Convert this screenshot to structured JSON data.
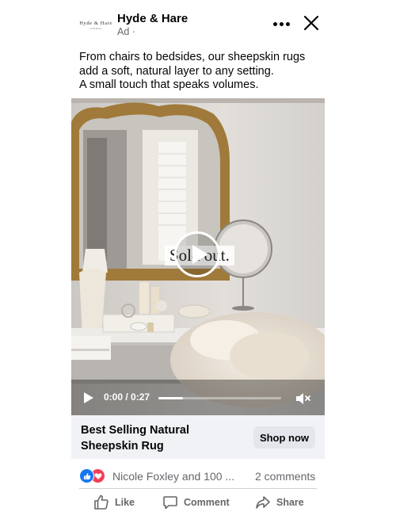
{
  "page": {
    "name": "Hyde & Hare",
    "subtitle": "Ad ·",
    "logo_text": "Hyde & Hare",
    "logo_tagline": "LONDON"
  },
  "caption": {
    "lines": [
      "From chairs to bedsides, our sheepskin rugs",
      "add a soft, natural layer to any setting.",
      "A small touch that speaks volumes."
    ]
  },
  "video": {
    "overlay_text": "Sold out.",
    "time": "0:00 / 0:27",
    "progress": 0.2,
    "muted": true
  },
  "cta": {
    "title_line1": "Best Selling Natural",
    "title_line2": "Sheepskin Rug",
    "button_label": "Shop now"
  },
  "stats": {
    "reactors": "Nicole Foxley and 100 ...",
    "comments": "2 comments"
  },
  "actions": {
    "like": "Like",
    "comment": "Comment",
    "share": "Share"
  },
  "colors": {
    "accent": "#1877f2",
    "love": "#f33e58",
    "secondary_text": "#65676b",
    "cta_background": "#f0f2f5"
  },
  "icons": [
    "more-options-icon",
    "close-icon",
    "play-icon",
    "volume-muted-icon",
    "like-reaction-icon",
    "love-reaction-icon",
    "thumbs-up-icon",
    "comment-icon",
    "share-icon"
  ]
}
